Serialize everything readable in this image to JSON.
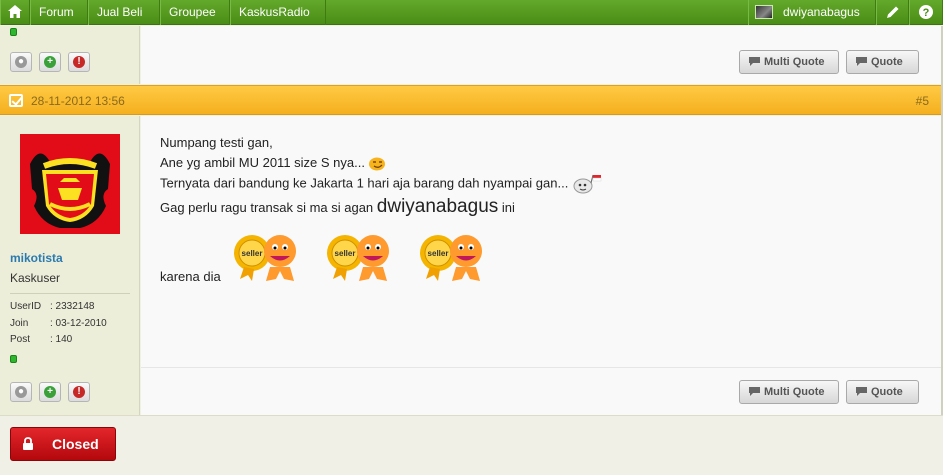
{
  "nav": {
    "items": [
      "Forum",
      "Jual Beli",
      "Groupee",
      "KaskusRadio"
    ],
    "username": "dwiyanabagus",
    "home_icon": "home-icon",
    "edit_icon": "pencil-icon",
    "help_icon": "question-icon"
  },
  "buttons": {
    "multi_quote": "Multi Quote",
    "quote": "Quote",
    "closed": "Closed"
  },
  "post": {
    "date": "28-11-2012 13:56",
    "number": "#5",
    "author": {
      "name": "mikotista",
      "rank": "Kaskuser",
      "meta": [
        {
          "key": "UserID",
          "value": ": 2332148"
        },
        {
          "key": "Join",
          "value": ": 03-12-2010"
        },
        {
          "key": "Post",
          "value": ": 140"
        }
      ]
    },
    "lines": {
      "l1": "Numpang testi gan,",
      "l2": "Ane yg ambil MU 2011 size S nya...",
      "l3": "Ternyata dari bandung ke Jakarta 1 hari aja barang dah nyampai gan...",
      "l4a": "Gag perlu ragu transak si ma si agan ",
      "l4b": "dwiyanabagus",
      "l4c": " ini",
      "l5": "karena dia",
      "seller_badge": "seller"
    }
  },
  "colors": {
    "nav_green": "#4a8d17",
    "header_orange": "#f5b01f",
    "closed_red": "#c41016",
    "username_blue": "#2a7ab0"
  }
}
